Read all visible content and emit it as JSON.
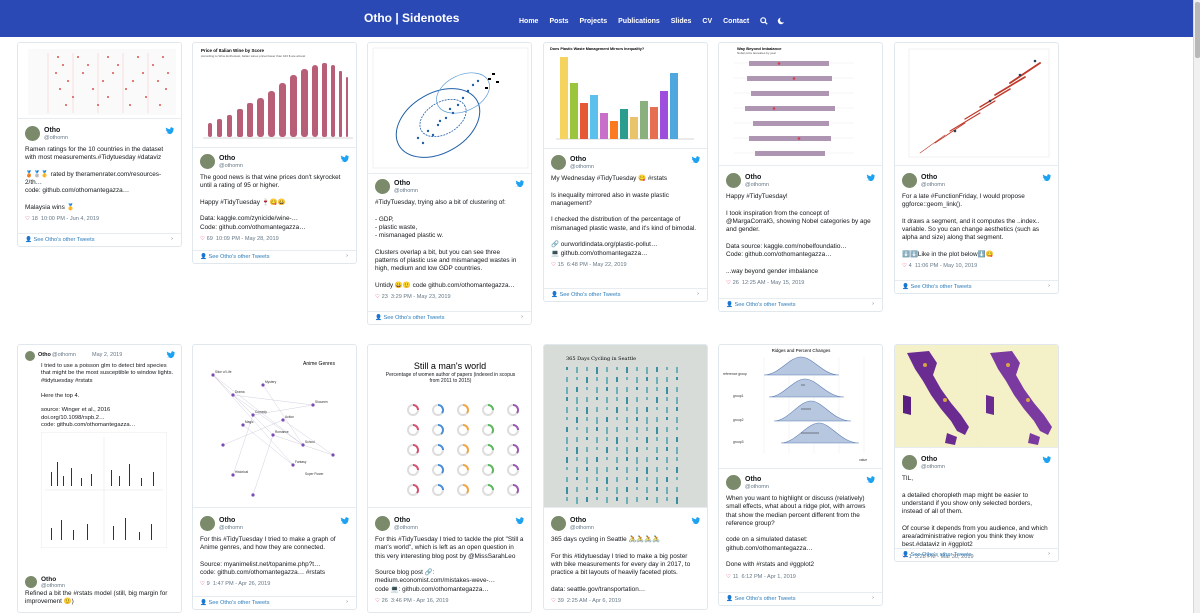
{
  "site": {
    "brand": "Otho | Sidenotes",
    "nav": [
      "Home",
      "Posts",
      "Projects",
      "Publications",
      "Slides",
      "CV",
      "Contact"
    ],
    "icons": [
      "search-icon",
      "moon-icon"
    ]
  },
  "footer_label": "See Otho's other Tweets",
  "tweets": [
    {
      "name": "Otho",
      "handle": "@othomn",
      "text": "Ramen ratings for the 10 countries in the dataset with most measurements.#Tidytuesday #dataviz\n\n🥉🥈🥇 rated by theramenrater.com/resources-2/th…\ncode: github.com/othomantegazza…\n\nMalaysia wins 🥇",
      "likes": "18",
      "time": "10:00 PM - Jun 4, 2019"
    },
    {
      "name": "Otho",
      "handle": "@othomn",
      "text": "The good news is that wine prices don't skyrocket until a rating of 95 or higher.\n\nHappy #TidyTuesday 🍷😋😄\n\nData: kaggle.com/zynicide/wine-…\nCode: github.com/othomantegazza…",
      "likes": "69",
      "time": "10:09 PM - May 28, 2019"
    },
    {
      "name": "Otho",
      "handle": "@othomn",
      "text": "#TidyTuesday, trying also a bit of clustering of:\n\n- GDP,\n- plastic waste,\n- mismanaged plastic w.\n\nClusters overlap a bit, but you can see three patterns of plastic use and mismanaged wastes in high, medium and low GDP countries.\n\nUntidy 😀🙂 code github.com/othomantegazza…",
      "likes": "23",
      "time": "3:29 PM - May 23, 2019"
    },
    {
      "name": "Otho",
      "handle": "@othomn",
      "text": "My Wednesday #TidyTuesday 😋 #rstats\n\nIs inequality mirrored also in waste plastic management?\n\nI checked the distribution of the percentage of mismanaged plastic waste, and it's kind of bimodal.\n\n🔗 ourworldindata.org/plastic-pollut…\n💻 github.com/othomantegazza…",
      "likes": "15",
      "time": "6:48 PM - May 22, 2019"
    },
    {
      "name": "Otho",
      "handle": "@othomn",
      "text": "Happy #TidyTuesday!\n\nI took inspiration from the concept of @MargaCorralG, showing Nobel categories by age and gender.\n\nData source: kaggle.com/nobelfoundatio…\nCode: github.com/othomantegazza…\n\n...way beyond gender imbalance",
      "likes": "26",
      "time": "12:25 AM - May 15, 2019"
    },
    {
      "name": "Otho",
      "handle": "@othomn",
      "text": "For a late #FunctionFriday, I would propose ggforce::geom_link().\n\nIt draws a segment, and it computes the ..index.. variable. So you can change aesthetics (such as alpha and size) along that segment.\n\n⬇️⬇️Like in the plot below⬇️😋",
      "likes": "4",
      "time": "11:06 PM - May 10, 2019"
    },
    {
      "name": "Otho",
      "handle": "@othomn",
      "date": "May 2, 2019",
      "text": "I tried to use a poisson glm to detect bird species that might be the most susceptible to window lights. #tidytuesday #rstats\n\nHere the top 4.\n\nsource: Winger et al., 2016\ndoi.org/10.1098/rspb.2…\ncode: github.com/othomantegazza…",
      "footer_name": "Otho",
      "footer_handle": "@othomn",
      "footer_text": "Refined a bit the #rstats model (still, big margin for improvement 🙂)"
    },
    {
      "name": "Otho",
      "handle": "@othomn",
      "text": "For this #TidyTuesday I tried to make a graph of Anime genres, and how they are connected.\n\nSource: myanimelist.net/topanime.php?t…\ncode: github.com/othomantegazza… #rstats",
      "likes": "9",
      "time": "1:47 PM - Apr 26, 2019"
    },
    {
      "name": "Otho",
      "handle": "@othomn",
      "text": "For this #TidyTuesday I tried to tackle the plot \"Still a man's world\", which is left as an open question in this very interesting blog post by @MissSarahLeo\n\nSource blog post 🔗:\nmedium.economist.com/mistakes-weve-…\ncode 💻: github.com/othomantegazza…",
      "likes": "26",
      "time": "3:46 PM - Apr 16, 2019"
    },
    {
      "name": "Otho",
      "handle": "@othomn",
      "text": "365 days cycling in Seattle 🚴🚴🚴🚴\n\nFor this #tidytuesday I tried to make a big poster with bike measurements for every day in 2017, to practice a bit layouts of heavily faceted plots.\n\ndata: seattle.gov/transportation…",
      "likes": "39",
      "time": "2:25 AM - Apr 6, 2019"
    },
    {
      "name": "Otho",
      "handle": "@othomn",
      "text": "When you want to highlight or discuss (relatively) small effects, what about a ridge plot, with arrows that show the median percent different from the reference group?\n\ncode on a simulated dataset: github.com/othomantegazza…\n\nDone with #rstats and #ggplot2",
      "likes": "11",
      "time": "6:12 PM - Apr 1, 2019"
    },
    {
      "name": "Otho",
      "handle": "@othomn",
      "text": "TIL,\n\na detailed choropleth map might be easier to understand if you show only selected borders, instead of all of them.\n\nOf course it depends from you audience, and which area/administrative region you think they know best.#dataviz in #ggplot2",
      "likes": "1",
      "time": "3:28 PM - Mar 30, 2019"
    }
  ],
  "images": {
    "wine": {
      "title": "Price of Italian Wine by Score",
      "subtitle": "According to Wine Enthusiast, Italian wines priced lower than 100 $ are almost"
    },
    "plastic": {
      "title": "Does Plastic Waste Management Mirrors Inequality?"
    },
    "nobel": {
      "title": "Way Beyond Imbalance",
      "subtitle": "Nobel prize laureates by year"
    },
    "anime": {
      "title": "Anime Genres",
      "labels": [
        "Slice of Life",
        "Drama",
        "Comedy",
        "Romance",
        "School",
        "Shounen",
        "Action",
        "Magic",
        "Fantasy",
        "Super Power",
        "Mystery",
        "Historical"
      ]
    },
    "mans_world": {
      "title": "Still a man's world",
      "subtitle": "Percentage of women author of papers (indexed in scopus from 2011 to 2015)"
    },
    "seattle": {
      "title": "365 Days Cycling in Seattle"
    },
    "ridges": {
      "title": "Ridges and Percent Changes",
      "groups": [
        "reference group",
        "group1",
        "group2",
        "group3"
      ],
      "xlabel": "value"
    }
  }
}
